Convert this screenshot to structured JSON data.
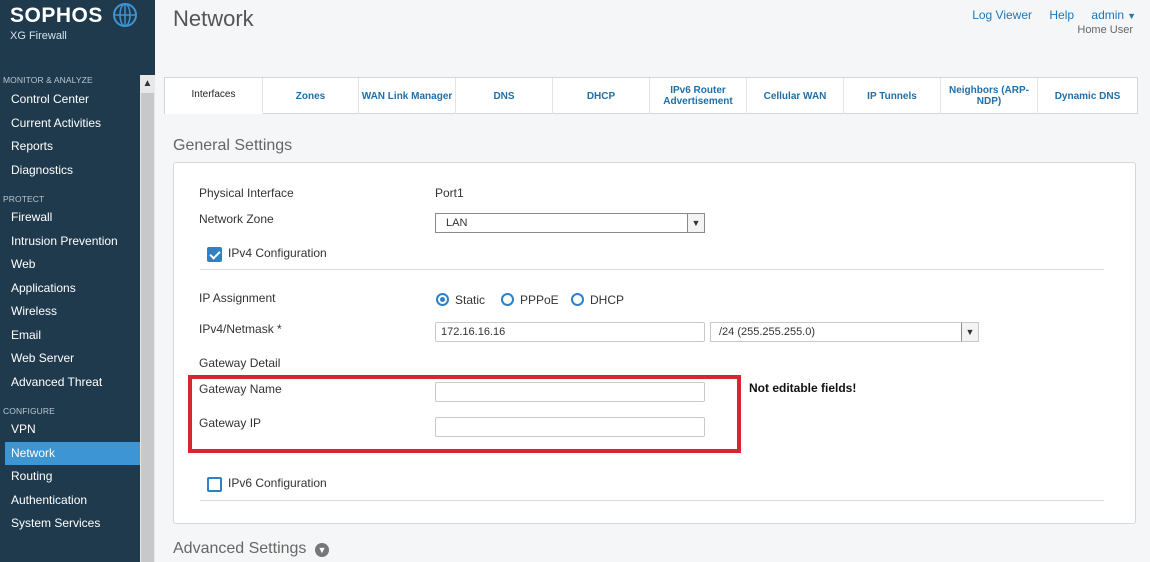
{
  "brand": {
    "name": "SOPHOS",
    "product": "XG Firewall"
  },
  "header": {
    "title": "Network",
    "links": [
      "Log Viewer",
      "Help",
      "admin"
    ],
    "user_role": "Home User"
  },
  "sidebar": {
    "sections": [
      {
        "label": "MONITOR & ANALYZE",
        "items": [
          "Control Center",
          "Current Activities",
          "Reports",
          "Diagnostics"
        ]
      },
      {
        "label": "PROTECT",
        "items": [
          "Firewall",
          "Intrusion Prevention",
          "Web",
          "Applications",
          "Wireless",
          "Email",
          "Web Server",
          "Advanced Threat"
        ]
      },
      {
        "label": "CONFIGURE",
        "items": [
          "VPN",
          "Network",
          "Routing",
          "Authentication",
          "System Services"
        ]
      }
    ],
    "active_item": "Network"
  },
  "tabs": [
    "Interfaces",
    "Zones",
    "WAN Link Manager",
    "DNS",
    "DHCP",
    "IPv6 Router Advertisement",
    "Cellular WAN",
    "IP Tunnels",
    "Neighbors (ARP-NDP)",
    "Dynamic DNS"
  ],
  "general": {
    "title": "General Settings",
    "physical_interface_label": "Physical Interface",
    "physical_interface_value": "Port1",
    "network_zone_label": "Network Zone",
    "network_zone_value": "LAN",
    "ipv4_config_label": "IPv4 Configuration",
    "ip_assignment_label": "IP Assignment",
    "ip_assignment_options": [
      "Static",
      "PPPoE",
      "DHCP"
    ],
    "ipv4_netmask_label": "IPv4/Netmask *",
    "ipv4_value": "172.16.16.16",
    "netmask_value": "/24 (255.255.255.0)",
    "gateway_detail_label": "Gateway Detail",
    "gateway_name_label": "Gateway Name",
    "gateway_name_value": "",
    "gateway_ip_label": "Gateway IP",
    "gateway_ip_value": "",
    "ipv6_config_label": "IPv6 Configuration"
  },
  "annotation": "Not editable fields!",
  "advanced": {
    "title": "Advanced Settings"
  },
  "colors": {
    "sidebar_bg": "#1f3a4d",
    "accent": "#3e95d4",
    "annotation_red": "#d9262e"
  }
}
